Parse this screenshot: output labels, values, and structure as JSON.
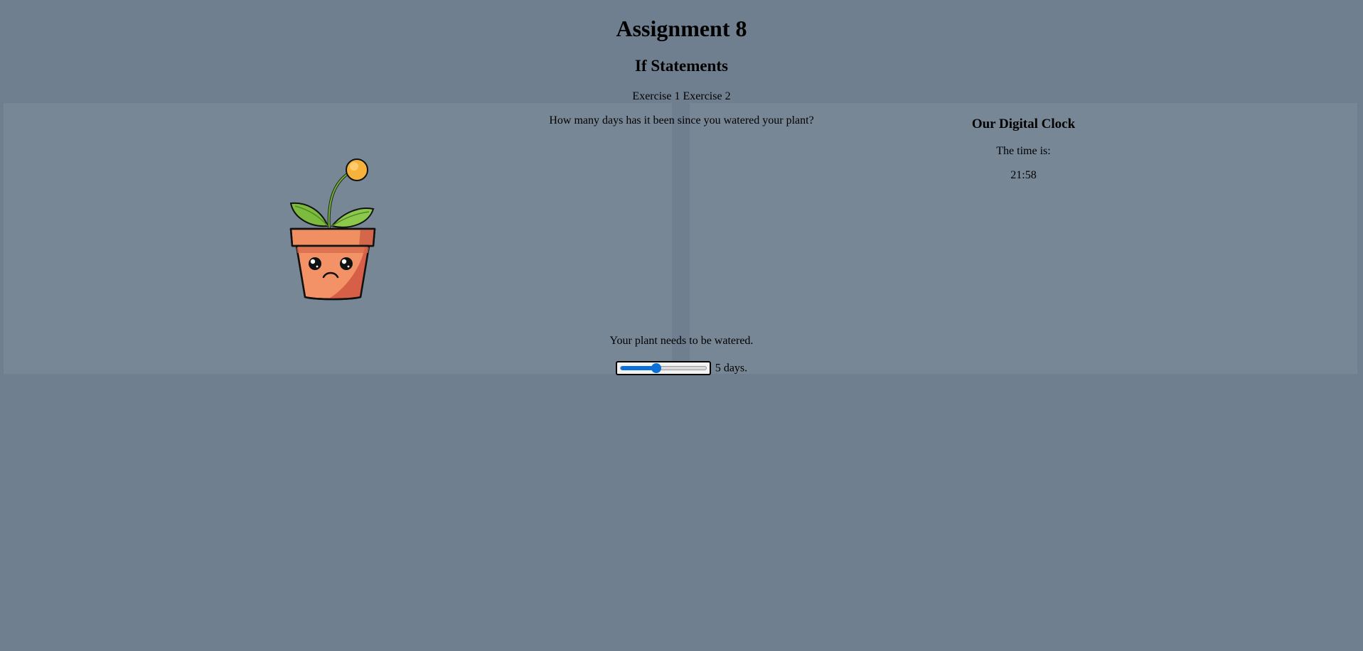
{
  "header": {
    "title": "Assignment 8",
    "subtitle": "If Statements"
  },
  "nav": {
    "exercises": [
      "Exercise 1",
      "Exercise 2"
    ]
  },
  "exercise1": {
    "question": "How many days has it been since you watered your plant?",
    "plant_image": "sad-potted-plant-icon",
    "status": "Your plant needs to be watered.",
    "slider": {
      "value": 5,
      "min": 0,
      "max": 12,
      "value_text": "5 days."
    }
  },
  "exercise2": {
    "title": "Our Digital Clock",
    "time_label": "The time is:",
    "time": "21:58"
  },
  "colors": {
    "background": "#6f7f8f",
    "panel": "#778796",
    "slider_accent": "#0a6fd6"
  }
}
